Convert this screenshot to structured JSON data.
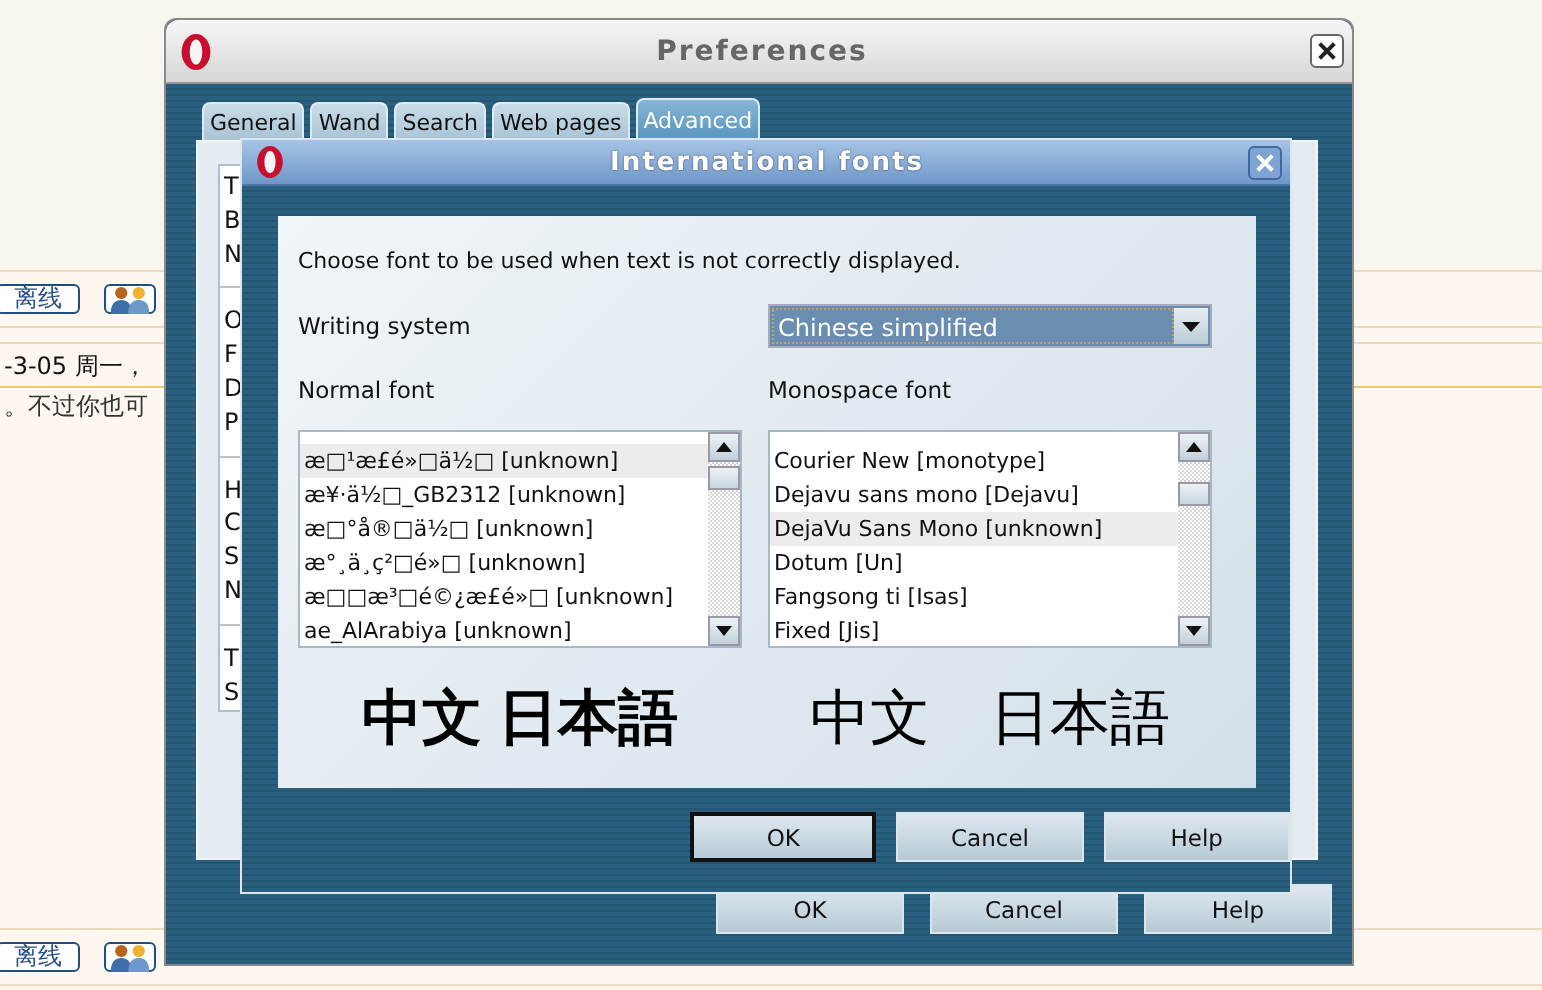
{
  "page": {
    "status_button_top": "离线",
    "date_text": "-3-05 周一，",
    "message_text": "。不过你也可",
    "status_button_bottom": "离线"
  },
  "preferences": {
    "title": "Preferences",
    "tabs": [
      {
        "label": "General",
        "selected": false
      },
      {
        "label": "Wand",
        "selected": false
      },
      {
        "label": "Search",
        "selected": false
      },
      {
        "label": "Web pages",
        "selected": false
      },
      {
        "label": "Advanced",
        "selected": true
      }
    ],
    "list_groups": [
      [
        "T",
        "B",
        "N"
      ],
      [
        "O",
        "F",
        "D",
        "P"
      ],
      [
        "H",
        "C",
        "S",
        "N"
      ],
      [
        "T",
        "S"
      ]
    ],
    "buttons": [
      "OK",
      "Cancel",
      "Help"
    ]
  },
  "dialog": {
    "title": "International fonts",
    "instruction": "Choose font to be used when text is not correctly displayed.",
    "writing_system": {
      "label": "Writing system",
      "value": "Chinese simplified"
    },
    "normal_font": {
      "label": "Normal font",
      "items": [
        {
          "text": "æ□¹æ£é»□ä½□ [unknown]",
          "selected": true
        },
        {
          "text": "æ¥·ä½□_GB2312 [unknown]",
          "selected": false
        },
        {
          "text": "æ□°å®□ä½□ [unknown]",
          "selected": false
        },
        {
          "text": "æ°¸ä¸ç²□é»□ [unknown]",
          "selected": false
        },
        {
          "text": "æ□□æ³□é©¿æ£é»□ [unknown]",
          "selected": false
        },
        {
          "text": "ae_AlArabiya [unknown]",
          "selected": false
        }
      ]
    },
    "monospace_font": {
      "label": "Monospace font",
      "items": [
        {
          "text": "Courier New [monotype]",
          "selected": false
        },
        {
          "text": "Dejavu sans mono [Dejavu]",
          "selected": false
        },
        {
          "text": "DejaVu Sans Mono [unknown]",
          "selected": true
        },
        {
          "text": "Dotum [Un]",
          "selected": false
        },
        {
          "text": "Fangsong ti [Isas]",
          "selected": false
        },
        {
          "text": "Fixed [Jis]",
          "selected": false
        }
      ]
    },
    "preview_normal": "中文 日本語",
    "preview_mono": "中文　日本語",
    "buttons": [
      {
        "label": "OK",
        "default": true
      },
      {
        "label": "Cancel",
        "default": false
      },
      {
        "label": "Help",
        "default": false
      }
    ]
  }
}
